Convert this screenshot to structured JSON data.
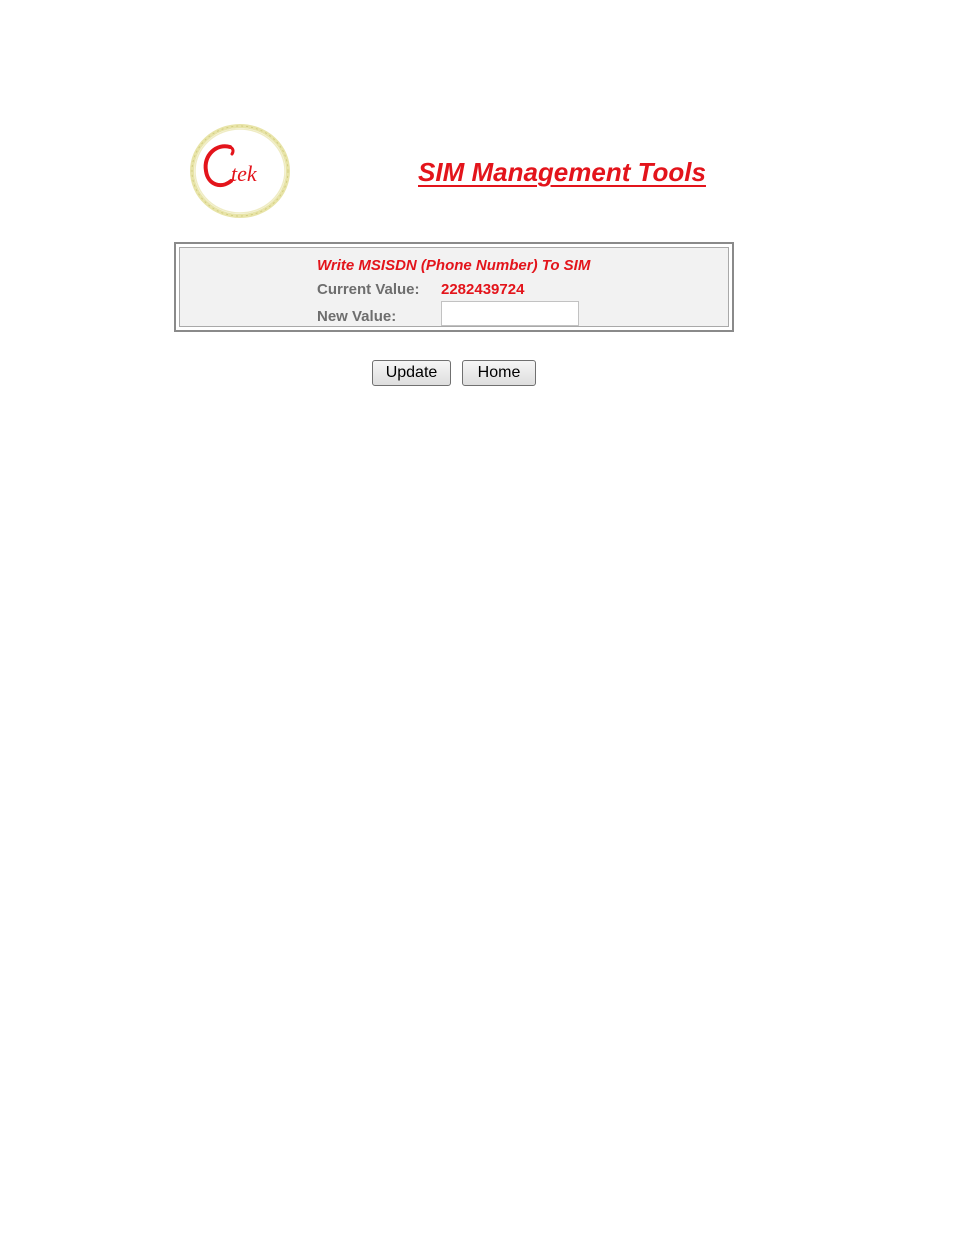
{
  "header": {
    "logo_text": "Ctek",
    "title": "SIM Management Tools"
  },
  "form": {
    "heading": "Write MSISDN (Phone Number) To SIM",
    "current_label": "Current Value:",
    "current_value": "2282439724",
    "new_label": "New Value:",
    "new_value": "",
    "new_placeholder": ""
  },
  "buttons": {
    "update_label": "Update",
    "home_label": "Home"
  },
  "colors": {
    "accent": "#e3141b",
    "label_gray": "#6e6e6e",
    "logo_ring": "#e6e2a2"
  }
}
